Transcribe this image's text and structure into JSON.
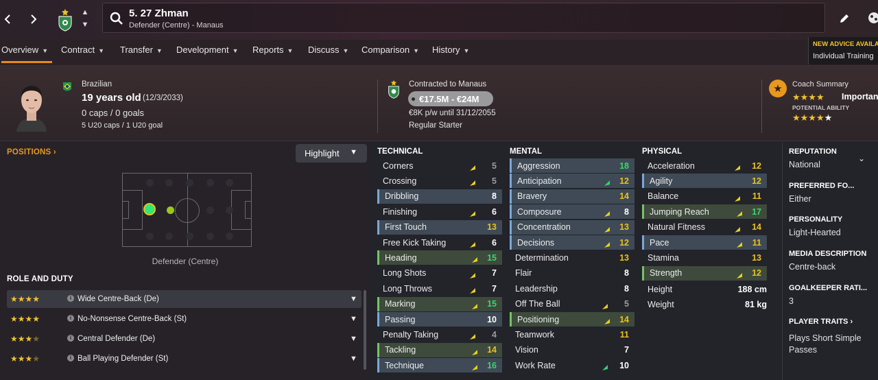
{
  "header": {
    "player_name": "5. 27 Zhman",
    "player_sub": "Defender (Centre) - Manaus",
    "back_icon": "chevron-left-icon",
    "forward_icon": "chevron-right-icon",
    "search_icon": "search-icon",
    "edit_icon": "pencil-icon",
    "globe_icon": "globe-icon"
  },
  "tabs": [
    {
      "label": "Overview",
      "active": true
    },
    {
      "label": "Contract"
    },
    {
      "label": "Transfer"
    },
    {
      "label": "Development"
    },
    {
      "label": "Reports"
    },
    {
      "label": "Discuss"
    },
    {
      "label": "Comparison"
    },
    {
      "label": "History"
    }
  ],
  "advice": {
    "title": "NEW ADVICE AVAILA",
    "text": "Individual Training"
  },
  "bio": {
    "nationality": "Brazilian",
    "age": "19 years old",
    "dob": "(12/3/2033)",
    "caps": "0 caps / 0 goals",
    "u20": "5 U20 caps / 1 U20 goal"
  },
  "contract": {
    "label": "Contracted to Manaus",
    "value": "€17.5M - €24M",
    "wage": "€8K p/w until 31/12/2055",
    "status": "Regular Starter"
  },
  "coach": {
    "label": "Coach Summary",
    "current_stars": 4,
    "importance": "Importan",
    "potential_label": "POTENTIAL ABILITY",
    "potential_stars": 4.5
  },
  "positions": {
    "title": "POSITIONS",
    "highlight": "Highlight",
    "label": "Defender (Centre)"
  },
  "roles": {
    "title": "ROLE AND DUTY",
    "items": [
      {
        "name": "Wide Centre-Back (De)",
        "stars": 4
      },
      {
        "name": "No-Nonsense Centre-Back (St)",
        "stars": 4
      },
      {
        "name": "Central Defender (De)",
        "stars": 3.5
      },
      {
        "name": "Ball Playing Defender (St)",
        "stars": 3.5
      }
    ]
  },
  "technical": {
    "title": "TECHNICAL",
    "attrs": [
      {
        "name": "Corners",
        "value": "5",
        "trend": "up",
        "hl": ""
      },
      {
        "name": "Crossing",
        "value": "5",
        "trend": "up",
        "hl": ""
      },
      {
        "name": "Dribbling",
        "value": "8",
        "trend": "",
        "hl": "blue"
      },
      {
        "name": "Finishing",
        "value": "6",
        "trend": "up",
        "hl": ""
      },
      {
        "name": "First Touch",
        "value": "13",
        "trend": "",
        "hl": "blue"
      },
      {
        "name": "Free Kick Taking",
        "value": "6",
        "trend": "up",
        "hl": ""
      },
      {
        "name": "Heading",
        "value": "15",
        "trend": "up",
        "hl": "green"
      },
      {
        "name": "Long Shots",
        "value": "7",
        "trend": "up",
        "hl": ""
      },
      {
        "name": "Long Throws",
        "value": "7",
        "trend": "up",
        "hl": ""
      },
      {
        "name": "Marking",
        "value": "15",
        "trend": "up",
        "hl": "green"
      },
      {
        "name": "Passing",
        "value": "10",
        "trend": "",
        "hl": "blue"
      },
      {
        "name": "Penalty Taking",
        "value": "4",
        "trend": "up",
        "hl": ""
      },
      {
        "name": "Tackling",
        "value": "14",
        "trend": "up",
        "hl": "green"
      },
      {
        "name": "Technique",
        "value": "16",
        "trend": "up",
        "hl": "blue"
      }
    ]
  },
  "mental": {
    "title": "MENTAL",
    "attrs": [
      {
        "name": "Aggression",
        "value": "18",
        "trend": "",
        "hl": "blue"
      },
      {
        "name": "Anticipation",
        "value": "12",
        "trend": "upg",
        "hl": "blue"
      },
      {
        "name": "Bravery",
        "value": "14",
        "trend": "",
        "hl": "blue"
      },
      {
        "name": "Composure",
        "value": "8",
        "trend": "up",
        "hl": "blue"
      },
      {
        "name": "Concentration",
        "value": "13",
        "trend": "up",
        "hl": "blue"
      },
      {
        "name": "Decisions",
        "value": "12",
        "trend": "up",
        "hl": "blue"
      },
      {
        "name": "Determination",
        "value": "13",
        "trend": "",
        "hl": ""
      },
      {
        "name": "Flair",
        "value": "8",
        "trend": "",
        "hl": ""
      },
      {
        "name": "Leadership",
        "value": "8",
        "trend": "",
        "hl": ""
      },
      {
        "name": "Off The Ball",
        "value": "5",
        "trend": "up",
        "hl": ""
      },
      {
        "name": "Positioning",
        "value": "14",
        "trend": "up",
        "hl": "green"
      },
      {
        "name": "Teamwork",
        "value": "11",
        "trend": "",
        "hl": ""
      },
      {
        "name": "Vision",
        "value": "7",
        "trend": "",
        "hl": ""
      },
      {
        "name": "Work Rate",
        "value": "10",
        "trend": "upg",
        "hl": ""
      }
    ]
  },
  "physical": {
    "title": "PHYSICAL",
    "attrs": [
      {
        "name": "Acceleration",
        "value": "12",
        "trend": "up",
        "hl": ""
      },
      {
        "name": "Agility",
        "value": "12",
        "trend": "",
        "hl": "blue"
      },
      {
        "name": "Balance",
        "value": "11",
        "trend": "up",
        "hl": ""
      },
      {
        "name": "Jumping Reach",
        "value": "17",
        "trend": "up",
        "hl": "green"
      },
      {
        "name": "Natural Fitness",
        "value": "14",
        "trend": "up",
        "hl": ""
      },
      {
        "name": "Pace",
        "value": "11",
        "trend": "up",
        "hl": "blue"
      },
      {
        "name": "Stamina",
        "value": "13",
        "trend": "",
        "hl": ""
      },
      {
        "name": "Strength",
        "value": "12",
        "trend": "up",
        "hl": "green"
      }
    ],
    "height_label": "Height",
    "height": "188 cm",
    "weight_label": "Weight",
    "weight": "81 kg"
  },
  "side": {
    "reputation_title": "REPUTATION",
    "reputation": "National",
    "foot_title": "PREFERRED FO...",
    "foot": "Either",
    "personality_title": "PERSONALITY",
    "personality": "Light-Hearted",
    "media_title": "MEDIA DESCRIPTION",
    "media": "Centre-back",
    "gk_title": "GOALKEEPER RATI...",
    "gk": "3",
    "traits_title": "PLAYER TRAITS",
    "trait_1": "Plays Short Simple",
    "trait_2": "Passes"
  },
  "colors": {
    "accent": "#e8891e",
    "great": "#36d86e",
    "good": "#e8c21e",
    "highlight_blue": "#3f4a56",
    "highlight_green": "#3e4a3c"
  }
}
